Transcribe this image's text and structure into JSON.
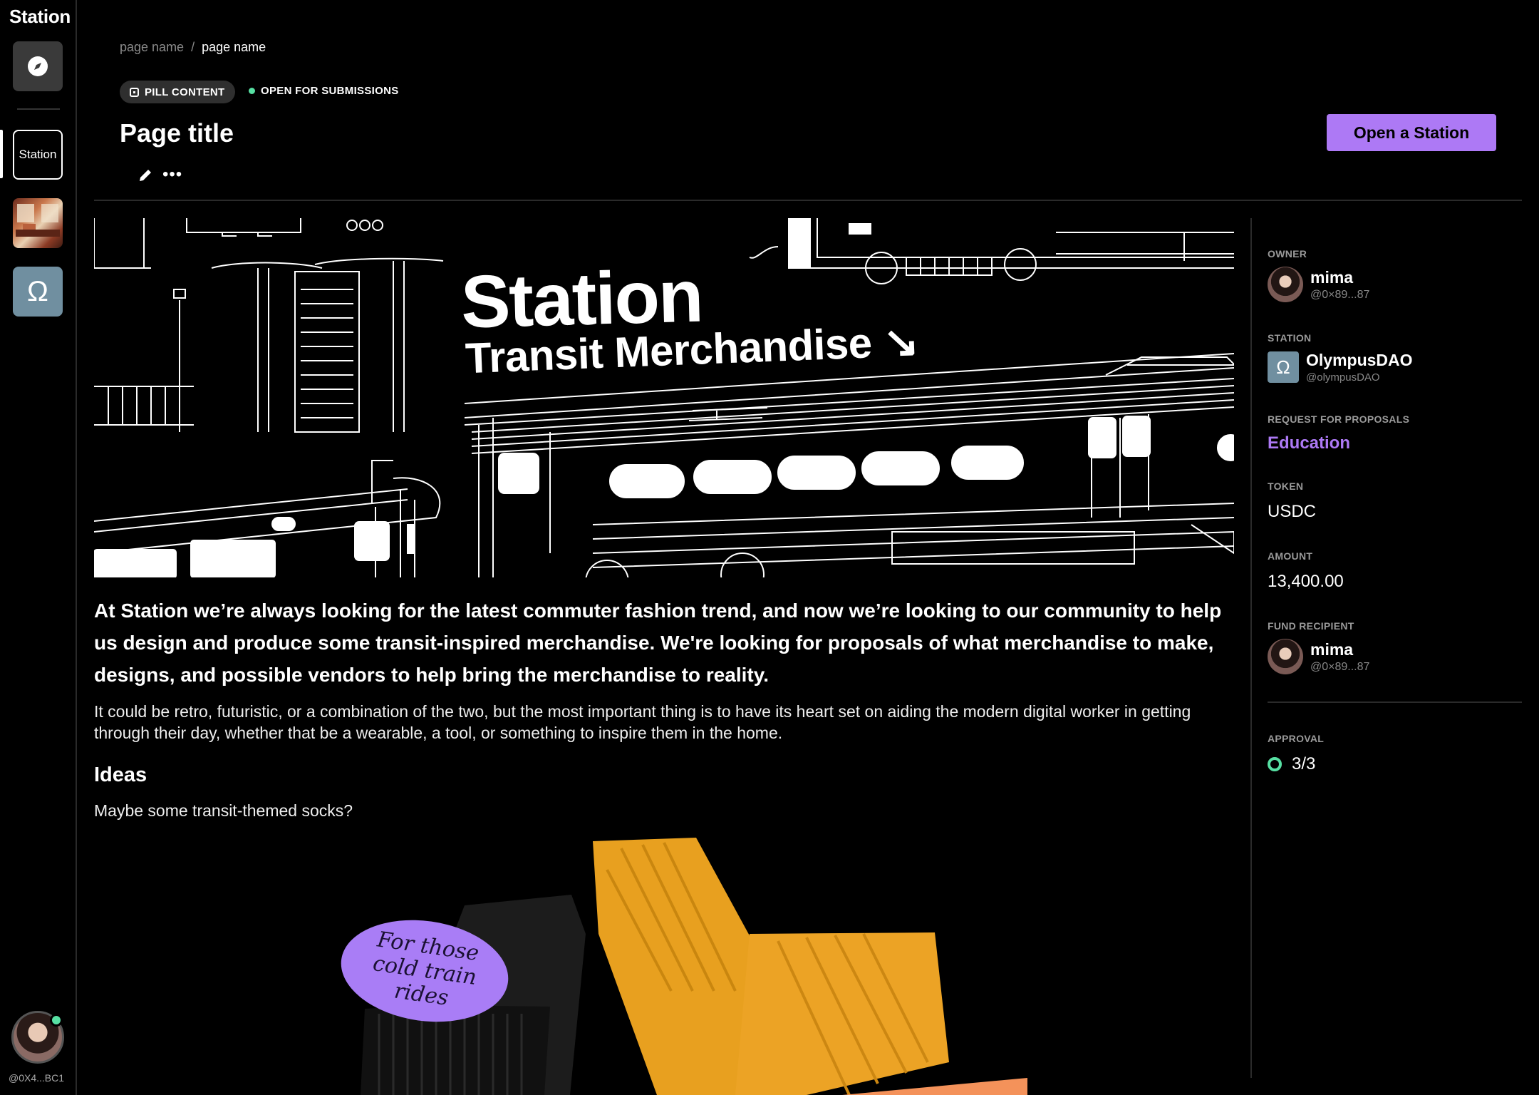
{
  "app": {
    "brand": "Station",
    "accent_color": "#ad79f5",
    "success_color": "#57e0a3"
  },
  "sidebar": {
    "explore_icon": "compass-icon",
    "items": [
      {
        "label": "Station",
        "active": true
      },
      {
        "label": "",
        "icon": "interior-thumbnail"
      },
      {
        "label": "",
        "icon": "omega-icon"
      }
    ],
    "user_handle": "@0X4...BC1"
  },
  "breadcrumb": {
    "parent": "page name",
    "separator": "/",
    "current": "page name"
  },
  "header": {
    "pill": "PILL CONTENT",
    "status": "OPEN FOR SUBMISSIONS",
    "title": "Page title",
    "cta": "Open a Station"
  },
  "hero": {
    "title": "Station",
    "subtitle": "Transit Merchandise ↘"
  },
  "content": {
    "lead": "At Station we’re always looking for the latest commuter fashion trend, and now we’re looking to our community to help us design and produce some transit-inspired merchandise. We're looking for proposals of what merchandise to make, designs, and possible vendors to help bring the merchandise to reality.",
    "body": "It could be retro, futuristic, or a combination of the two, but the most important thing is to have its heart set on aiding the modern digital worker in getting through their day, whether that be a wearable, a tool, or something to inspire them in the home.",
    "ideas_heading": "Ideas",
    "ideas_body": "Maybe some transit-themed socks?",
    "sock_tag": "For those cold train rides"
  },
  "panel": {
    "owner": {
      "label": "OWNER",
      "name": "mima",
      "handle": "@0×89...87"
    },
    "station": {
      "label": "STATION",
      "name": "OlympusDAO",
      "handle": "@olympusDAO",
      "icon": "Ω"
    },
    "rfp": {
      "label": "REQUEST FOR PROPOSALS",
      "value": "Education"
    },
    "token": {
      "label": "TOKEN",
      "value": "USDC"
    },
    "amount": {
      "label": "AMOUNT",
      "value": "13,400.00"
    },
    "fund_recipient": {
      "label": "FUND RECIPIENT",
      "name": "mima",
      "handle": "@0×89...87"
    },
    "approval": {
      "label": "APPROVAL",
      "value": "3/3"
    }
  }
}
